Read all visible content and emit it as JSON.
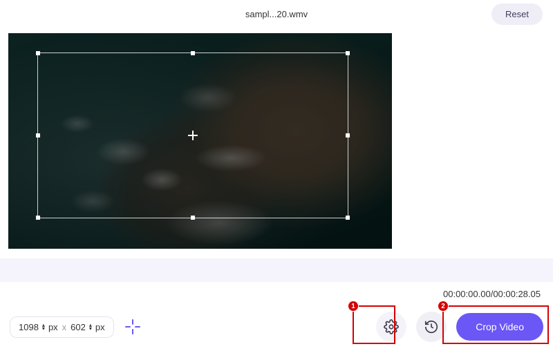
{
  "header": {
    "filename": "sampl...20.wmv",
    "reset_label": "Reset"
  },
  "crop": {
    "width": "1098",
    "height": "602",
    "unit": "px",
    "separator": "x"
  },
  "timecode": {
    "current": "00:00:00.00",
    "duration": "00:00:28.05"
  },
  "actions": {
    "settings_icon": "settings",
    "history_icon": "history",
    "crop_button_label": "Crop Video"
  },
  "annotations": {
    "one": "1",
    "two": "2"
  },
  "colors": {
    "accent": "#6B57F5",
    "annotation": "#d40000"
  }
}
